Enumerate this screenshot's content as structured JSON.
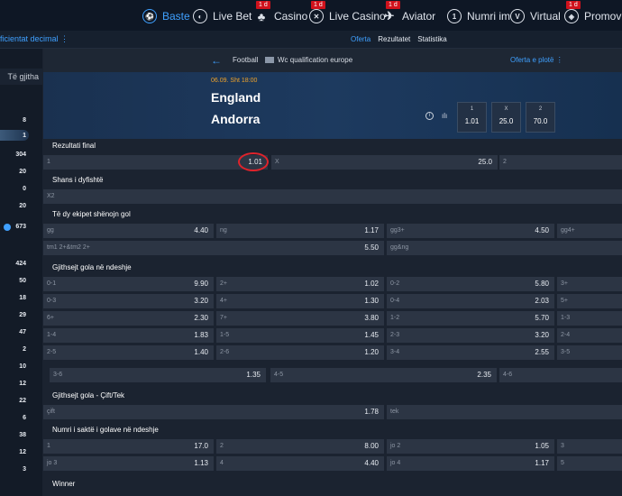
{
  "nav": {
    "items": [
      {
        "label": "Baste",
        "icon": "soccer-ball-icon",
        "active": true,
        "badge": ""
      },
      {
        "label": "Live Bet",
        "icon": "live-icon",
        "active": false,
        "badge": ""
      },
      {
        "label": "Casino",
        "icon": "casino-chips-icon",
        "active": false,
        "badge": "1 d"
      },
      {
        "label": "Live Casino",
        "icon": "live-casino-icon",
        "active": false,
        "badge": "1 d"
      },
      {
        "label": "Aviator",
        "icon": "plane-icon",
        "active": false,
        "badge": "1 d"
      },
      {
        "label": "Numri im",
        "icon": "number-icon",
        "active": false,
        "badge": ""
      },
      {
        "label": "Virtual",
        "icon": "virtual-icon",
        "active": false,
        "badge": ""
      },
      {
        "label": "Promovime",
        "icon": "promo-icon",
        "active": false,
        "badge": "1 d"
      }
    ]
  },
  "subnav": {
    "left": "ficientat decimal ⋮",
    "links": [
      "Oferta",
      "Rezultatet",
      "Statistika"
    ]
  },
  "sidebar": {
    "header": "Të gjitha",
    "counts": [
      "8",
      "1",
      "304",
      "20",
      "0",
      "20",
      "673",
      "424",
      "50",
      "18",
      "29",
      "47",
      "2",
      "10",
      "12",
      "22",
      "6",
      "38",
      "12",
      "3"
    ]
  },
  "breadcrumb": {
    "back": "←",
    "sport": "Football",
    "league": "Wc qualification europe",
    "full_offer": "Oferta e plotë ⋮"
  },
  "match": {
    "datetime": "06.09. Sht 18:00",
    "home": "England",
    "away": "Andorra",
    "info_icon": "i",
    "stats_icon": "ılı",
    "odds": [
      {
        "label": "1",
        "value": "1.01"
      },
      {
        "label": "X",
        "value": "25.0"
      },
      {
        "label": "2",
        "value": "70.0"
      }
    ]
  },
  "markets": [
    {
      "title": "Rezultati final"
    },
    {
      "title": "Shans i dyfishtë"
    },
    {
      "title": "Të dy ekipet shënojn gol"
    },
    {
      "title": "Gjithsejt gola në ndeshje"
    },
    {
      "title": "Gjithsejt gola - Çift/Tek"
    },
    {
      "title": "Numri i saktë i golave në ndeshje"
    },
    {
      "title": "Winner"
    }
  ],
  "rows": {
    "r1": [
      [
        "1",
        "1.01"
      ],
      [
        "X",
        "25.0"
      ],
      [
        "2",
        ""
      ]
    ],
    "r2": [
      [
        "X2",
        ""
      ]
    ],
    "r3a": [
      [
        "gg",
        "4.40"
      ],
      [
        "ng",
        "1.17"
      ],
      [
        "gg3+",
        "4.50"
      ],
      [
        "gg4+",
        ""
      ]
    ],
    "r3b": [
      [
        "tm1 2+&tm2 2+",
        "5.50"
      ],
      [
        "gg&ng",
        ""
      ]
    ],
    "r4a": [
      [
        "0-1",
        "9.90"
      ],
      [
        "2+",
        "1.02"
      ],
      [
        "0-2",
        "5.80"
      ],
      [
        "3+",
        ""
      ]
    ],
    "r4b": [
      [
        "0-3",
        "3.20"
      ],
      [
        "4+",
        "1.30"
      ],
      [
        "0-4",
        "2.03"
      ],
      [
        "5+",
        ""
      ]
    ],
    "r4c": [
      [
        "6+",
        "2.30"
      ],
      [
        "7+",
        "3.80"
      ],
      [
        "1-2",
        "5.70"
      ],
      [
        "1-3",
        ""
      ]
    ],
    "r4d": [
      [
        "1-4",
        "1.83"
      ],
      [
        "1-5",
        "1.45"
      ],
      [
        "2-3",
        "3.20"
      ],
      [
        "2-4",
        ""
      ]
    ],
    "r4e": [
      [
        "2-5",
        "1.40"
      ],
      [
        "2-6",
        "1.20"
      ],
      [
        "3-4",
        "2.55"
      ],
      [
        "3-5",
        ""
      ]
    ],
    "r4f": [
      [
        "3-6",
        "1.35"
      ],
      [
        "4-5",
        "2.35"
      ],
      [
        "4-6",
        ""
      ]
    ],
    "r5": [
      [
        "çift",
        "1.78"
      ],
      [
        "tek",
        ""
      ]
    ],
    "r6a": [
      [
        "1",
        "17.0"
      ],
      [
        "2",
        "8.00"
      ],
      [
        "jo 2",
        "1.05"
      ],
      [
        "3",
        ""
      ]
    ],
    "r6b": [
      [
        "jo 3",
        "1.13"
      ],
      [
        "4",
        "4.40"
      ],
      [
        "jo 4",
        "1.17"
      ],
      [
        "5",
        ""
      ]
    ]
  }
}
